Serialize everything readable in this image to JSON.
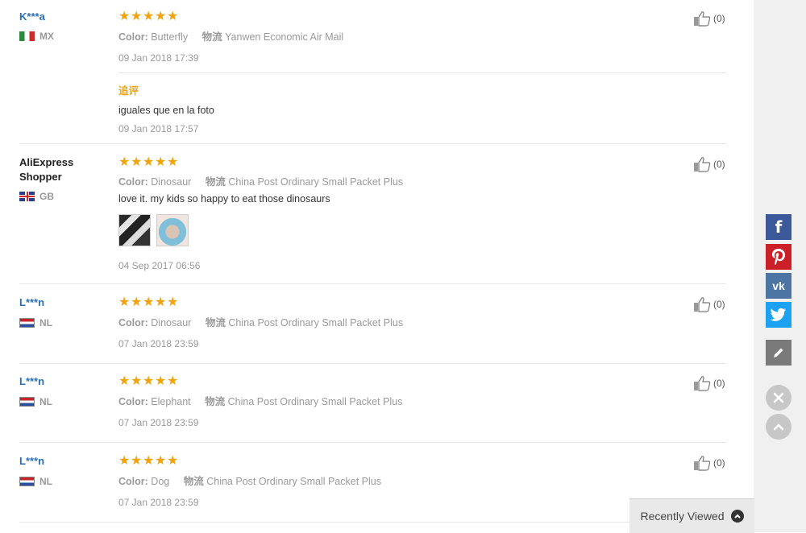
{
  "reviews": [
    {
      "buyer": "K***a",
      "country": "MX",
      "rating": 5,
      "color_label": "Color:",
      "color_value": "Butterfly",
      "shipping_label": "物流",
      "shipping_value": "Yanwen Economic Air Mail",
      "date": "09 Jan 2018 17:39",
      "likes": "(0)",
      "followup_label": "追评",
      "followup_text": "iguales que en la foto",
      "followup_date": "09 Jan 2018 17:57"
    },
    {
      "buyer": "AliExpress Shopper",
      "country": "GB",
      "rating": 5,
      "color_label": "Color:",
      "color_value": "Dinosaur",
      "shipping_label": "物流",
      "shipping_value": "China Post Ordinary Small Packet Plus",
      "text": "love it. my kids so happy to eat those dinosaurs",
      "date": "04 Sep 2017 06:56",
      "likes": "(0)"
    },
    {
      "buyer": "L***n",
      "country": "NL",
      "rating": 5,
      "color_label": "Color:",
      "color_value": "Dinosaur",
      "shipping_label": "物流",
      "shipping_value": "China Post Ordinary Small Packet Plus",
      "date": "07 Jan 2018 23:59",
      "likes": "(0)"
    },
    {
      "buyer": "L***n",
      "country": "NL",
      "rating": 5,
      "color_label": "Color:",
      "color_value": "Elephant",
      "shipping_label": "物流",
      "shipping_value": "China Post Ordinary Small Packet Plus",
      "date": "07 Jan 2018 23:59",
      "likes": "(0)"
    },
    {
      "buyer": "L***n",
      "country": "NL",
      "rating": 5,
      "color_label": "Color:",
      "color_value": "Dog",
      "shipping_label": "物流",
      "shipping_value": "China Post Ordinary Small Packet Plus",
      "date": "07 Jan 2018 23:59",
      "likes": "(0)"
    }
  ],
  "share_bar": {
    "facebook_icon": "f",
    "vk_icon": "vk"
  },
  "recently_viewed": "Recently Viewed",
  "colors": {
    "star": "#f0a30a",
    "buyer_link": "#2a6fb5",
    "followup": "#e8a21b",
    "facebook": "#3b5998",
    "pinterest": "#cb2027",
    "vk": "#4c75a3",
    "twitter": "#1da1f2"
  }
}
